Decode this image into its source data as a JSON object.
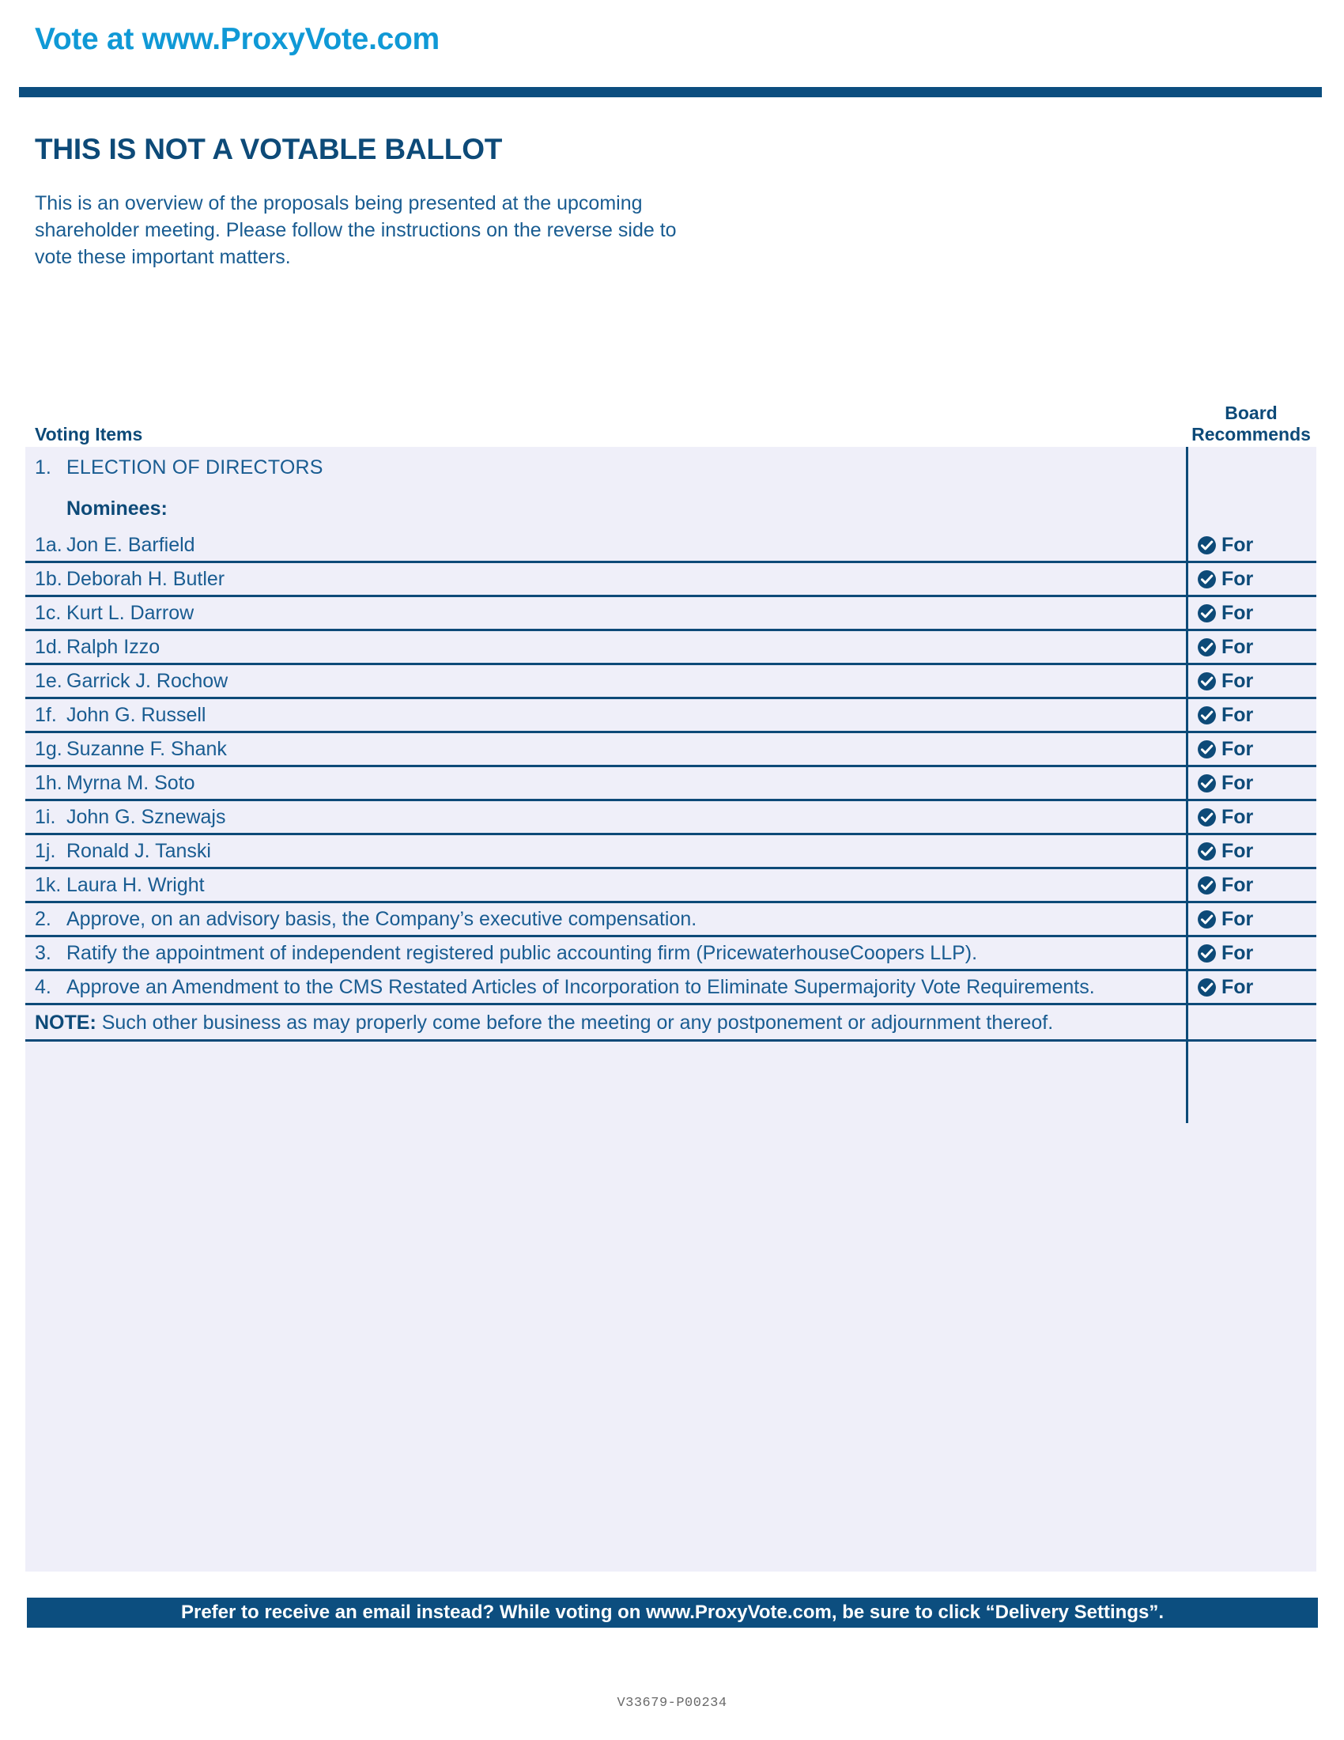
{
  "header": {
    "site_link": "Vote at www.ProxyVote.com"
  },
  "intro": {
    "title": "THIS IS NOT A VOTABLE BALLOT",
    "paragraph": "This is an overview of the proposals being presented at the upcoming shareholder meeting. Please follow the instructions on the reverse side to vote these important matters."
  },
  "table": {
    "col_items_header": "Voting Items",
    "col_recommend_header_line1": "Board",
    "col_recommend_header_line2": "Recommends",
    "rows": [
      {
        "num": "1.",
        "label": "ELECTION OF DIRECTORS",
        "rec": ""
      },
      {
        "num": "",
        "label": "Nominees:",
        "rec": ""
      },
      {
        "num": "1a.",
        "label": "Jon E. Barfield",
        "rec": "For"
      },
      {
        "num": "1b.",
        "label": "Deborah H. Butler",
        "rec": "For"
      },
      {
        "num": "1c.",
        "label": "Kurt L. Darrow",
        "rec": "For"
      },
      {
        "num": "1d.",
        "label": "Ralph Izzo",
        "rec": "For"
      },
      {
        "num": "1e.",
        "label": "Garrick J. Rochow",
        "rec": "For"
      },
      {
        "num": "1f.",
        "label": "John G. Russell",
        "rec": "For"
      },
      {
        "num": "1g.",
        "label": "Suzanne F. Shank",
        "rec": "For"
      },
      {
        "num": "1h.",
        "label": "Myrna M. Soto",
        "rec": "For"
      },
      {
        "num": "1i.",
        "label": "John G. Sznewajs",
        "rec": "For"
      },
      {
        "num": "1j.",
        "label": "Ronald J. Tanski",
        "rec": "For"
      },
      {
        "num": "1k.",
        "label": "Laura H. Wright",
        "rec": "For"
      },
      {
        "num": "2.",
        "label": "Approve, on an advisory basis, the Company’s executive compensation.",
        "rec": "For"
      },
      {
        "num": "3.",
        "label": "Ratify the appointment of independent registered public accounting firm (PricewaterhouseCoopers LLP).",
        "rec": "For"
      },
      {
        "num": "4.",
        "label": "Approve an Amendment to the CMS Restated Articles of Incorporation to Eliminate Supermajority Vote Requirements.",
        "rec": "For"
      }
    ],
    "note_label": "NOTE:",
    "note_text": "Such other business as may properly come before the meeting or any postponement or adjournment thereof."
  },
  "footer": {
    "message": "Prefer to receive an email instead? While voting on www.ProxyVote.com, be sure to click “Delivery Settings”.",
    "doc_code": "V33679-P00234"
  },
  "colors": {
    "accent_cyan": "#1099D6",
    "navy": "#0C4E7F",
    "text_blue": "#195C91",
    "table_bg": "#EFEFF9"
  }
}
